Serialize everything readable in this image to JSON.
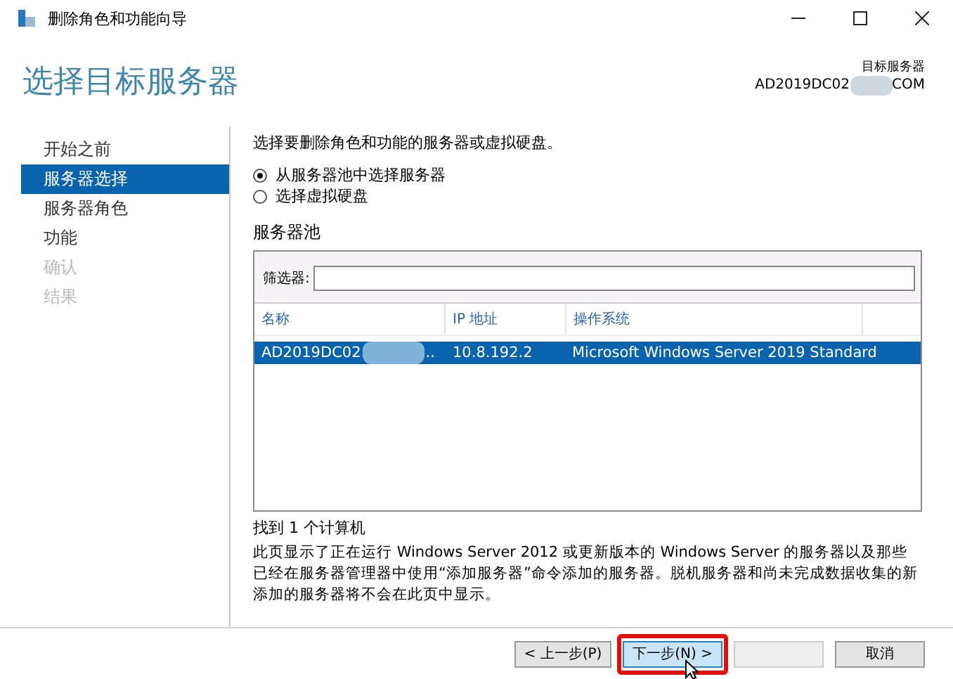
{
  "window": {
    "title": "删除角色和功能向导"
  },
  "header": {
    "title": "选择目标服务器",
    "target_label": "目标服务器",
    "target_name_start": "AD2019DC02",
    "target_name_end": "COM"
  },
  "steps": [
    {
      "label": "开始之前",
      "selected": false,
      "disabled": false
    },
    {
      "label": "服务器选择",
      "selected": true,
      "disabled": false
    },
    {
      "label": "服务器角色",
      "selected": false,
      "disabled": false
    },
    {
      "label": "功能",
      "selected": false,
      "disabled": false
    },
    {
      "label": "确认",
      "selected": false,
      "disabled": true
    },
    {
      "label": "结果",
      "selected": false,
      "disabled": true
    }
  ],
  "instruction": "选择要删除角色和功能的服务器或虚拟硬盘。",
  "options": [
    {
      "label": "从服务器池中选择服务器",
      "selected": true
    },
    {
      "label": "选择虚拟硬盘",
      "selected": false
    }
  ],
  "pool": {
    "title": "服务器池",
    "filter_label": "筛选器:",
    "columns": [
      "名称",
      "IP 地址",
      "操作系统"
    ],
    "rows": [
      {
        "name_start": "AD2019DC02",
        "name_end": "..",
        "ip": "10.8.192.2",
        "os": "Microsoft Windows Server 2019 Standard",
        "selected": true
      }
    ],
    "count": "找到 1 个计算机"
  },
  "note": "此页显示了正在运行 Windows Server 2012 或更新版本的 Windows Server 的服务器以及那些已经在服务器管理器中使用“添加服务器”命令添加的服务器。脱机服务器和尚未完成数据收集的新添加的服务器将不会在此页中显示。",
  "buttons": [
    {
      "label": "< 上一步(P)",
      "highlighted": false,
      "disabled": false
    },
    {
      "label": "下一步(N) >",
      "highlighted": true,
      "disabled": false
    },
    {
      "highlighted": false,
      "disabled": true
    },
    {
      "label": "取消",
      "highlighted": false,
      "disabled": false
    }
  ]
}
